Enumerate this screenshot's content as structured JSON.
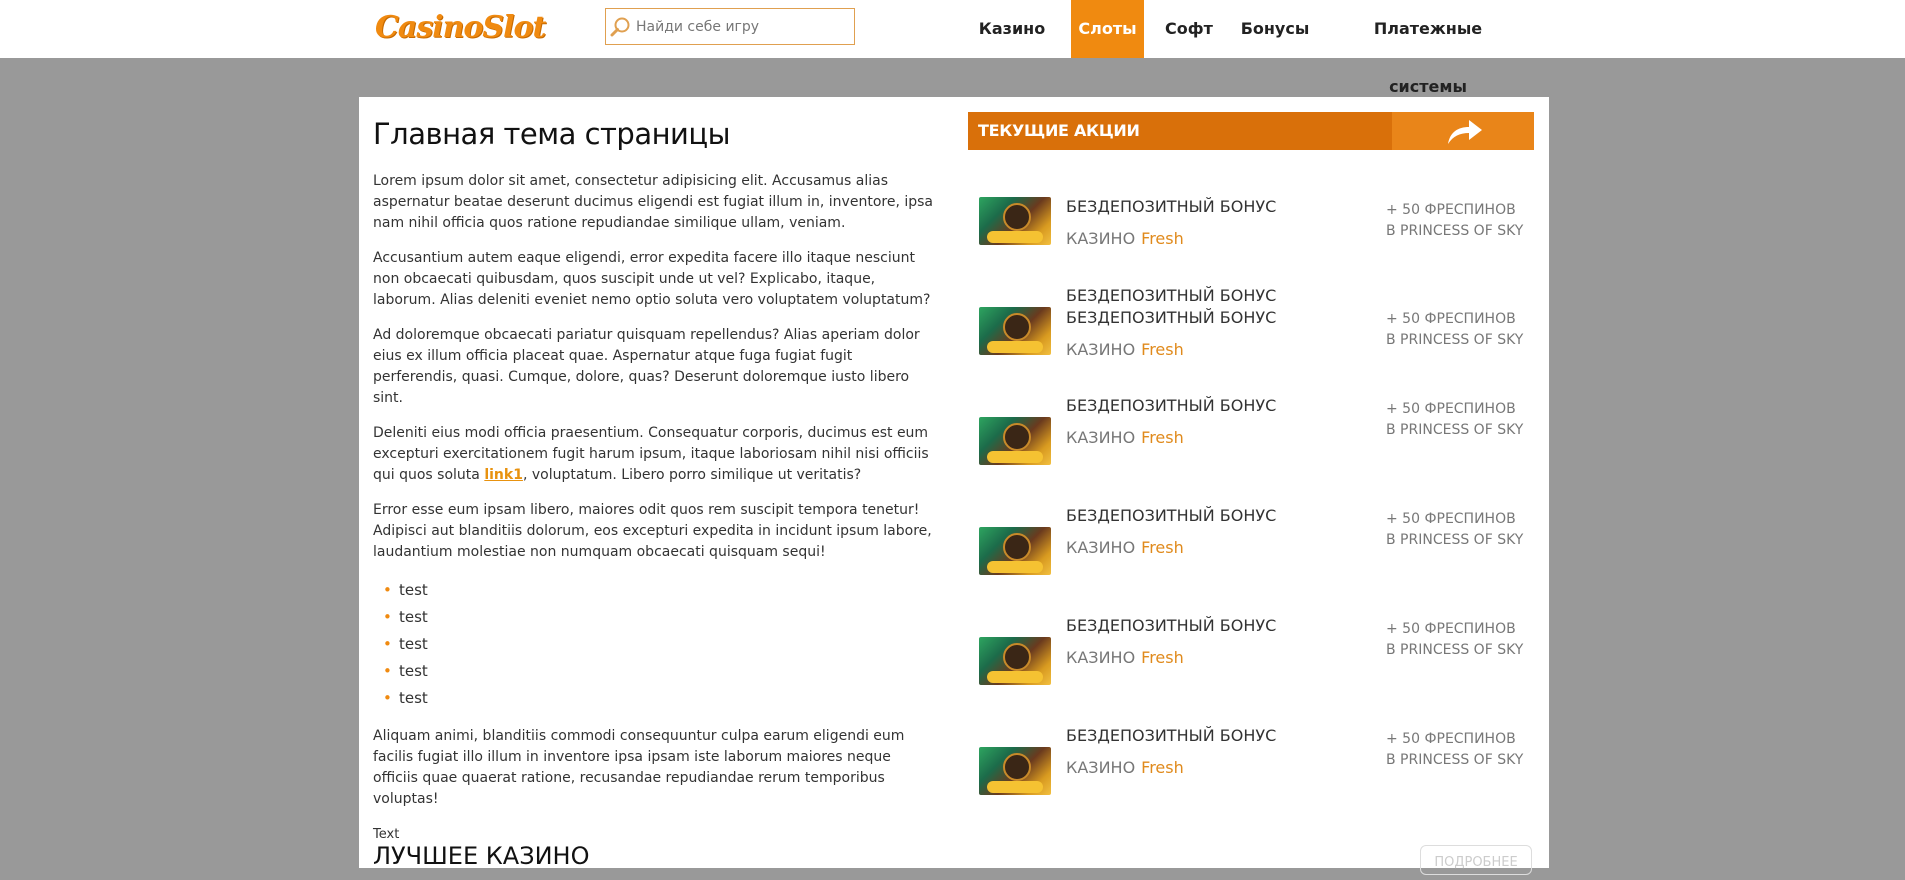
{
  "header": {
    "logo": "CasinoSlot",
    "search_placeholder": "Найди себе игру",
    "nav": [
      "Казино",
      "Слоты",
      "Софт",
      "Бонусы",
      "Платежные системы"
    ],
    "active_nav": "Слоты"
  },
  "main": {
    "title": "Главная тема страницы",
    "paragraphs": [
      "Lorem ipsum dolor sit amet, consectetur adipisicing elit. Accusamus alias aspernatur beatae deserunt ducimus eligendi est fugiat illum in, inventore, ipsa nam nihil officia quos ratione repudiandae similique ullam, veniam.",
      "Accusantium autem eaque eligendi, error expedita facere illo itaque nesciunt non obcaecati quibusdam, quos suscipit unde ut vel? Explicabo, itaque, laborum. Alias deleniti eveniet nemo optio soluta vero voluptatem voluptatum?",
      "Ad doloremque obcaecati pariatur quisquam repellendus? Alias aperiam dolor eius ex illum officia placeat quae. Aspernatur atque fuga fugiat fugit perferendis, quasi. Cumque, dolore, quas? Deserunt doloremque iusto libero sint."
    ],
    "p4_before": "Deleniti eius modi officia praesentium. Consequatur corporis, ducimus est eum excepturi exercitationem fugit harum ipsum, itaque laboriosam nihil nisi officiis qui quos soluta ",
    "p4_link": "link1",
    "p4_after": ", voluptatum. Libero porro similique ut veritatis?",
    "p5": "Error esse eum ipsam libero, maiores odit quos rem suscipit tempora tenetur! Adipisci aut blanditiis dolorum, eos excepturi expedita in incidunt ipsum labore, laudantium molestiae non numquam obcaecati quisquam sequi!",
    "list": [
      "test",
      "test",
      "test",
      "test",
      "test"
    ],
    "p6": "Aliquam animi, blanditiis commodi consequuntur culpa earum eligendi eum facilis fugiat illo illum in inventore ipsa ipsam iste laborum maiores neque officiis quae quaerat ratione, recusandae repudiandae rerum temporibus voluptas!",
    "small_text": "Text"
  },
  "best": {
    "title": "ЛУЧШЕЕ КАЗИНО",
    "more_button": "ПОДРОБНЕЕ"
  },
  "promo": {
    "title": "ТЕКУЩИЕ АКЦИИ",
    "offers": [
      {
        "name": [
          "БЕЗДЕПОЗИТНЫЙ БОНУС"
        ],
        "casino": "КАЗИНО",
        "brand": "Fresh",
        "bonus1": "+ 50 ФРЕСПИНОВ",
        "bonus2": "В PRINCESS OF SKY"
      },
      {
        "name": [
          "БЕЗДЕПОЗИТНЫЙ БОНУС",
          "БЕЗДЕПОЗИТНЫЙ БОНУС"
        ],
        "casino": "КАЗИНО",
        "brand": "Fresh",
        "bonus1": "+ 50 ФРЕСПИНОВ",
        "bonus2": "В PRINCESS OF SKY"
      },
      {
        "name": [
          "БЕЗДЕПОЗИТНЫЙ БОНУС"
        ],
        "casino": "КАЗИНО",
        "brand": "Fresh",
        "bonus1": "+ 50 ФРЕСПИНОВ",
        "bonus2": "В PRINCESS OF SKY"
      },
      {
        "name": [
          "БЕЗДЕПОЗИТНЫЙ БОНУС"
        ],
        "casino": "КАЗИНО",
        "brand": "Fresh",
        "bonus1": "+ 50 ФРЕСПИНОВ",
        "bonus2": "В PRINCESS OF SKY"
      },
      {
        "name": [
          "БЕЗДЕПОЗИТНЫЙ БОНУС"
        ],
        "casino": "КАЗИНО",
        "brand": "Fresh",
        "bonus1": "+ 50 ФРЕСПИНОВ",
        "bonus2": "В PRINCESS OF SKY"
      },
      {
        "name": [
          "БЕЗДЕПОЗИТНЫЙ БОНУС"
        ],
        "casino": "КАЗИНО",
        "brand": "Fresh",
        "bonus1": "+ 50 ФРЕСПИНОВ",
        "bonus2": "В PRINCESS OF SKY"
      }
    ]
  },
  "colors": {
    "accent": "#f08a10",
    "promo_header": "#d9700a",
    "page_bg": "#999999"
  }
}
